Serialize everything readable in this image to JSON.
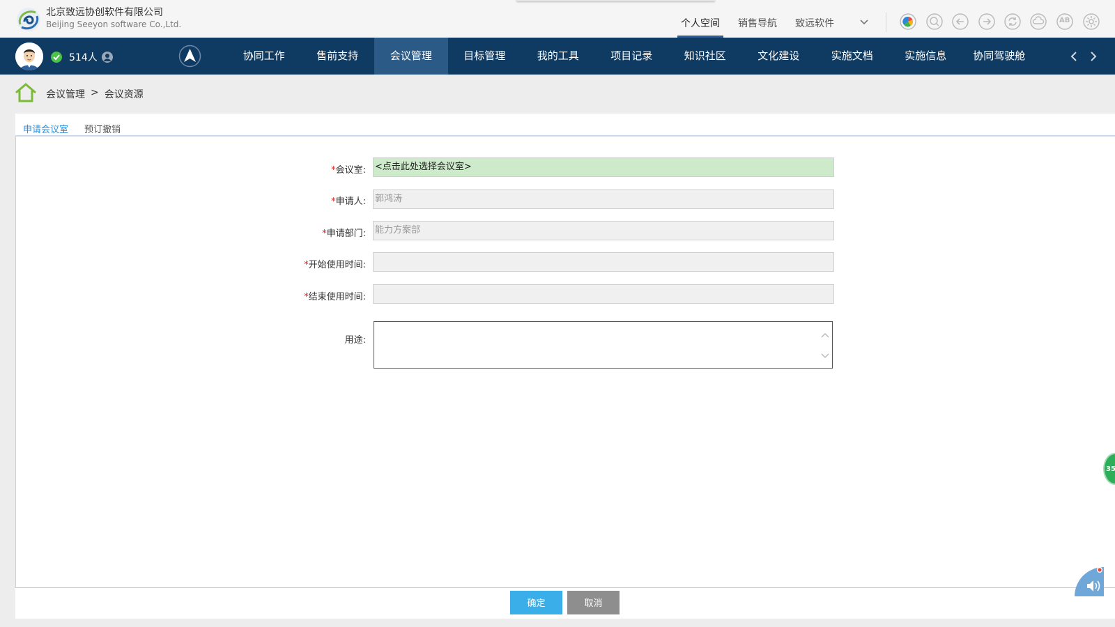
{
  "header": {
    "company_cn": "北京致远协创软件有限公司",
    "company_en": "Beijing Seeyon software Co.,Ltd.",
    "tabs": [
      {
        "label": "个人空间",
        "active": true
      },
      {
        "label": "销售导航",
        "active": false
      },
      {
        "label": "致远软件",
        "active": false
      }
    ],
    "tools": [
      "color-wheel-icon",
      "search-icon",
      "back-icon",
      "forward-icon",
      "refresh-icon",
      "cloud-icon",
      "ab-icon",
      "settings-icon"
    ],
    "tool_ab_text": "AB"
  },
  "nav": {
    "online_count": "514人",
    "items": [
      {
        "label": "协同工作"
      },
      {
        "label": "售前支持"
      },
      {
        "label": "会议管理",
        "active": true
      },
      {
        "label": "目标管理"
      },
      {
        "label": "我的工具"
      },
      {
        "label": "项目记录"
      },
      {
        "label": "知识社区"
      },
      {
        "label": "文化建设"
      },
      {
        "label": "实施文档"
      },
      {
        "label": "实施信息"
      },
      {
        "label": "协同驾驶舱"
      }
    ]
  },
  "breadcrumb": {
    "level1": "会议管理",
    "separator": ">",
    "level2": "会议资源"
  },
  "tabs": {
    "apply": "申请会议室",
    "cancel_booking": "预订撤销"
  },
  "form": {
    "required_mark": "*",
    "room_label": "会议室:",
    "room_value": "<点击此处选择会议室>",
    "applicant_label": "申请人:",
    "applicant_value": "郭鸿涛",
    "dept_label": "申请部门:",
    "dept_value": "能力方案部",
    "start_label": "开始使用时间:",
    "start_value": "",
    "end_label": "结束使用时间:",
    "end_value": "",
    "purpose_label": "用途:",
    "purpose_value": ""
  },
  "buttons": {
    "ok": "确定",
    "cancel": "取消"
  },
  "side_badge": "35",
  "colors": {
    "nav_bg": "#0f3a61",
    "nav_active": "#2c5a86",
    "tab_active": "#2f8fd6",
    "room_field": "#cdeacb",
    "ok_button": "#3aaee9",
    "cancel_button": "#8e8e8e",
    "required": "#e02020"
  }
}
